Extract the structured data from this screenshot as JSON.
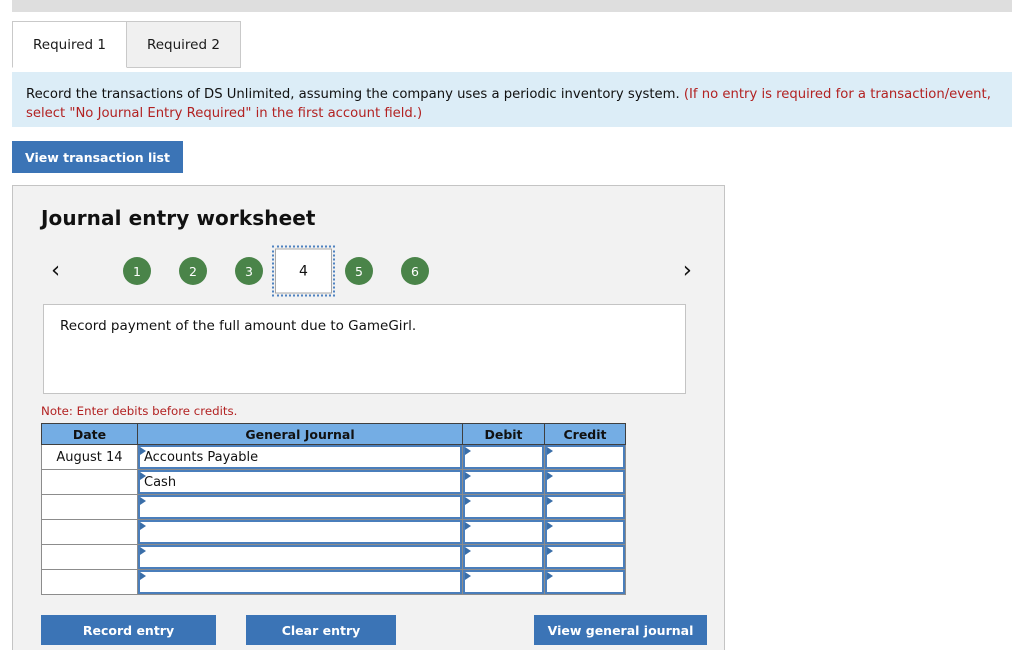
{
  "tabs": [
    {
      "label": "Required 1",
      "active": true
    },
    {
      "label": "Required 2",
      "active": false
    }
  ],
  "banner": {
    "main_text": "Record the transactions of DS Unlimited, assuming the company uses a periodic inventory system. ",
    "red_text": "(If no entry is required for a transaction/event, select \"No Journal Entry Required\" in the first account field.)"
  },
  "toolbar": {
    "view_transaction_list_label": "View transaction list"
  },
  "worksheet": {
    "title": "Journal entry worksheet",
    "prev_icon": "chevron-left-icon",
    "next_icon": "chevron-right-icon",
    "pages": [
      {
        "label": "1",
        "current": false
      },
      {
        "label": "2",
        "current": false
      },
      {
        "label": "3",
        "current": false
      },
      {
        "label": "4",
        "current": true
      },
      {
        "label": "5",
        "current": false
      },
      {
        "label": "6",
        "current": false
      }
    ],
    "description": "Record payment of the full amount due to GameGirl.",
    "note": "Note: Enter debits before credits."
  },
  "journal": {
    "headers": [
      "Date",
      "General Journal",
      "Debit",
      "Credit"
    ],
    "rows": [
      {
        "date": "August 14",
        "account": "Accounts Payable",
        "debit": "",
        "credit": ""
      },
      {
        "date": "",
        "account": "Cash",
        "debit": "",
        "credit": ""
      },
      {
        "date": "",
        "account": "",
        "debit": "",
        "credit": ""
      },
      {
        "date": "",
        "account": "",
        "debit": "",
        "credit": ""
      },
      {
        "date": "",
        "account": "",
        "debit": "",
        "credit": ""
      },
      {
        "date": "",
        "account": "",
        "debit": "",
        "credit": ""
      }
    ]
  },
  "actions": {
    "record_entry_label": "Record entry",
    "clear_entry_label": "Clear entry",
    "view_general_journal_label": "View general journal"
  },
  "colors": {
    "accent_blue": "#3b74b6",
    "header_blue": "#74ade4",
    "banner_blue": "#dcedf7",
    "page_green": "#4a8449",
    "red_text": "#b22222",
    "panel_gray": "#f2f2f2"
  }
}
